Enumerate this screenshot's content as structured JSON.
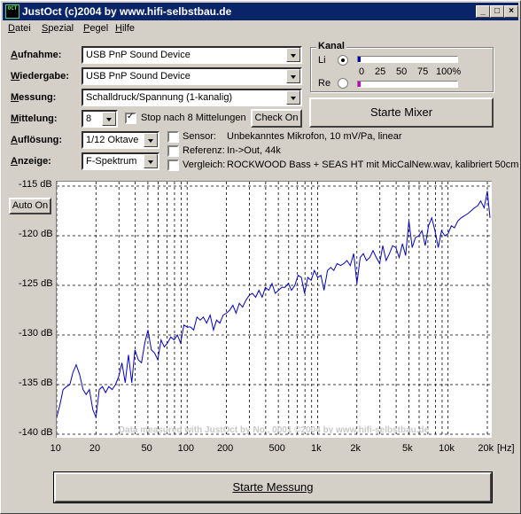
{
  "window": {
    "icon_text": "OCT",
    "title": "JustOct (c)2004 by www.hifi-selbstbau.de",
    "buttons": {
      "minimize": "_",
      "maximize": "□",
      "close": "×"
    }
  },
  "menu": [
    "Datei",
    "Spezial",
    "Pegel",
    "Hilfe"
  ],
  "fields": {
    "aufnahme": {
      "label": "Aufnahme:",
      "value": "USB PnP Sound Device"
    },
    "wiedergabe": {
      "label": "Wiedergabe:",
      "value": "USB PnP Sound Device"
    },
    "messung": {
      "label": "Messung:",
      "value": "Schalldruck/Spannung (1-kanalig)"
    },
    "mittelung": {
      "label": "Mittelung:",
      "value": "8",
      "stop_label": "Stop nach 8 Mittelungen",
      "stop_checked": true,
      "check_button": "Check On"
    },
    "aufloesung": {
      "label": "Auflösung:",
      "value": "1/12 Oktave"
    },
    "anzeige": {
      "label": "Anzeige:",
      "value": "F-Spektrum"
    }
  },
  "info": {
    "sensor": {
      "label": "Sensor:",
      "value": "Unbekanntes Mikrofon, 10 mV/Pa, linear"
    },
    "referenz": {
      "label": "Referenz:",
      "value": "In->Out, 44k"
    },
    "vergleich": {
      "label": "Vergleich:",
      "value": "ROCKWOOD Bass + SEAS HT mit MicCalNew.wav, kalibriert 50cm"
    }
  },
  "kanal": {
    "title": "Kanal",
    "li_label": "Li",
    "re_label": "Re",
    "selected": "Li",
    "scale": [
      "0",
      "25",
      "50",
      "75",
      "100%"
    ],
    "li_level": 0.02,
    "re_level": 0.02,
    "li_color": "#0000cc",
    "re_color": "#cc00cc"
  },
  "buttons": {
    "starte_mixer": "Starte Mixer",
    "auto_on": "Auto On",
    "starte_messung": "Starte Messung"
  },
  "chart_data": {
    "type": "line",
    "x_scale": "log",
    "xlim": [
      10,
      20000
    ],
    "ylim": [
      -140,
      -115
    ],
    "x_unit_label": "[Hz]",
    "y_tick_labels": [
      "-115 dB",
      "-120 dB",
      "-125 dB",
      "-130 dB",
      "-135 dB",
      "-140 dB"
    ],
    "y_ticks": [
      -115,
      -120,
      -125,
      -130,
      -135,
      -140
    ],
    "x_tick_labels": [
      "10",
      "20",
      "50",
      "100",
      "200",
      "500",
      "1k",
      "2k",
      "5k",
      "10k",
      "20k"
    ],
    "x_ticks": [
      10,
      20,
      50,
      100,
      200,
      500,
      1000,
      2000,
      5000,
      10000,
      20000
    ],
    "watermark": "Data measured with JustOct by No , 0001 ©2004 by www.hifi-selbstbau.de",
    "line_color": "#0000cc",
    "grid": true,
    "series": [
      {
        "x": [
          10,
          10.6,
          11.2,
          11.9,
          12.6,
          13.3,
          14.1,
          15,
          15.9,
          16.8,
          17.8,
          18.9,
          20,
          21.2,
          22.4,
          23.7,
          25.1,
          26.6,
          28.2,
          29.9,
          31.6,
          33.5,
          35.5,
          37.6,
          39.8,
          42.2,
          44.7,
          47.3,
          50.1,
          53.1,
          56.2,
          59.6,
          63.1,
          66.8,
          70.8,
          75,
          79.4,
          84.1,
          89.1,
          94.4,
          100,
          106,
          112,
          119,
          126,
          133,
          141,
          150,
          159,
          168,
          178,
          189,
          200,
          212,
          224,
          237,
          251,
          266,
          282,
          299,
          316,
          335,
          355,
          376,
          398,
          422,
          447,
          473,
          501,
          531,
          562,
          596,
          631,
          668,
          708,
          750,
          794,
          841,
          891,
          944,
          1000,
          1060,
          1120,
          1190,
          1260,
          1330,
          1410,
          1500,
          1590,
          1680,
          1780,
          1890,
          2000,
          2120,
          2240,
          2370,
          2510,
          2660,
          2820,
          2990,
          3160,
          3350,
          3550,
          3760,
          3980,
          4220,
          4470,
          4730,
          5010,
          5310,
          5620,
          5960,
          6310,
          6680,
          7080,
          7500,
          7940,
          8410,
          8910,
          9440,
          10000,
          10600,
          11200,
          11900,
          12600,
          13300,
          14100,
          15000,
          15900,
          16800,
          17800,
          18900,
          20000,
          21200
        ],
        "y": [
          -138.3,
          -137,
          -135.5,
          -135.2,
          -135,
          -133.8,
          -133,
          -134,
          -135.5,
          -136,
          -135.5,
          -137.5,
          -138.3,
          -135.5,
          -135.2,
          -135.8,
          -135.2,
          -135.5,
          -135,
          -134.2,
          -132.8,
          -134.8,
          -132,
          -134.8,
          -131.5,
          -132.5,
          -132.8,
          -130.8,
          -129.5,
          -131.5,
          -131.8,
          -132.5,
          -130.5,
          -131.2,
          -130.8,
          -130.2,
          -130.5,
          -130,
          -130.8,
          -129,
          -129.2,
          -129.2,
          -129.5,
          -128.2,
          -128.5,
          -128.2,
          -128.8,
          -128,
          -129.5,
          -128.5,
          -128.8,
          -128,
          -127.8,
          -127.5,
          -127,
          -127.8,
          -126.8,
          -127.2,
          -126.5,
          -126,
          -125.8,
          -126.2,
          -125.5,
          -126.2,
          -125.2,
          -125.5,
          -124.8,
          -125.8,
          -125.5,
          -125.2,
          -125.2,
          -124.8,
          -125.5,
          -125,
          -124,
          -124.2,
          -125.8,
          -124.2,
          -124.5,
          -123.5,
          -124.2,
          -124,
          -125.5,
          -123.5,
          -123.2,
          -123.5,
          -122.8,
          -123,
          -122.8,
          -122.5,
          -123,
          -121.8,
          -124.8,
          -122.2,
          -121.8,
          -122.5,
          -122.2,
          -121.5,
          -122.2,
          -122.8,
          -121,
          -122.5,
          -121.8,
          -121,
          -121.2,
          -122.2,
          -120.8,
          -122,
          -118.5,
          -121.2,
          -120.2,
          -120,
          -119.5,
          -121,
          -119,
          -118.2,
          -119.5,
          -121.2,
          -119.5,
          -120,
          -119.8,
          -119,
          -119.2,
          -118.5,
          -118.2,
          -118,
          -117.8,
          -117.5,
          -117.2,
          -117,
          -116.5,
          -117.2,
          -115.5,
          -118.2
        ]
      }
    ]
  }
}
